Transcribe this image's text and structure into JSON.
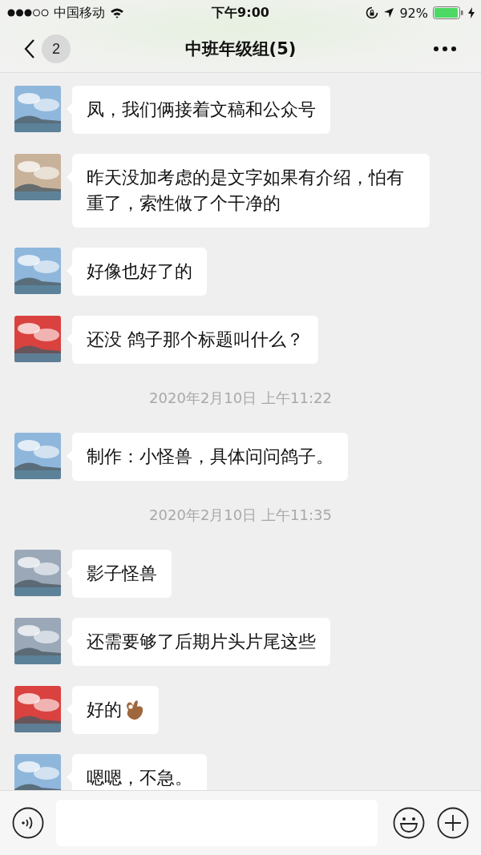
{
  "status_bar": {
    "carrier": "中国移动",
    "time": "下午9:00",
    "battery": "92%"
  },
  "nav": {
    "back_count": "2",
    "title": "中班年级组(5)"
  },
  "messages": [
    {
      "kind": "message",
      "color": "#8fb7dc",
      "text": "凤，我们俩接着文稿和公众号"
    },
    {
      "kind": "message",
      "color": "#c9b29a",
      "text": "昨天没加考虑的是文字如果有介绍，怕有重了，索性做了个干净的"
    },
    {
      "kind": "message",
      "color": "#8fb7dc",
      "text": "好像也好了的"
    },
    {
      "kind": "message",
      "color": "#d9423f",
      "text": "还没 鸽子那个标题叫什么？"
    },
    {
      "kind": "time",
      "text": "2020年2月10日 上午11:22"
    },
    {
      "kind": "message",
      "color": "#8fb7dc",
      "text": "制作：小怪兽，具体问问鸽子。"
    },
    {
      "kind": "time",
      "text": "2020年2月10日 上午11:35"
    },
    {
      "kind": "message",
      "color": "#9aa8b8",
      "text": "影子怪兽"
    },
    {
      "kind": "message",
      "color": "#9aa8b8",
      "text": "还需要够了后期片头片尾这些"
    },
    {
      "kind": "message",
      "color": "#d9423f",
      "text": "好的",
      "ok_hand": true
    },
    {
      "kind": "message",
      "color": "#8fb7dc",
      "text": "嗯嗯，不急。"
    }
  ]
}
